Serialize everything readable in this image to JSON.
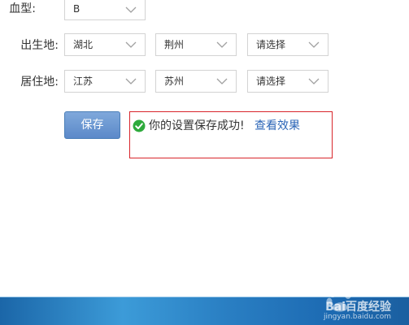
{
  "form": {
    "blood_type": {
      "label": "血型:",
      "value": "B"
    },
    "birthplace": {
      "label": "出生地:",
      "province": "湖北",
      "city": "荆州",
      "district": "请选择"
    },
    "residence": {
      "label": "居住地:",
      "province": "江苏",
      "city": "苏州",
      "district": "请选择"
    }
  },
  "save_button": {
    "label": "保存"
  },
  "message": {
    "text": "你的设置保存成功!",
    "link": "查看效果",
    "icon": "check-circle-icon",
    "border_color": "#d8252b",
    "icon_color": "#2eaa3c"
  },
  "watermark": {
    "main": "Bai百度经验",
    "sub": "jingyan.baidu.com"
  },
  "colors": {
    "button": "#6a97d2",
    "link": "#2b65b7",
    "taskbar": "#2a7fc3"
  }
}
